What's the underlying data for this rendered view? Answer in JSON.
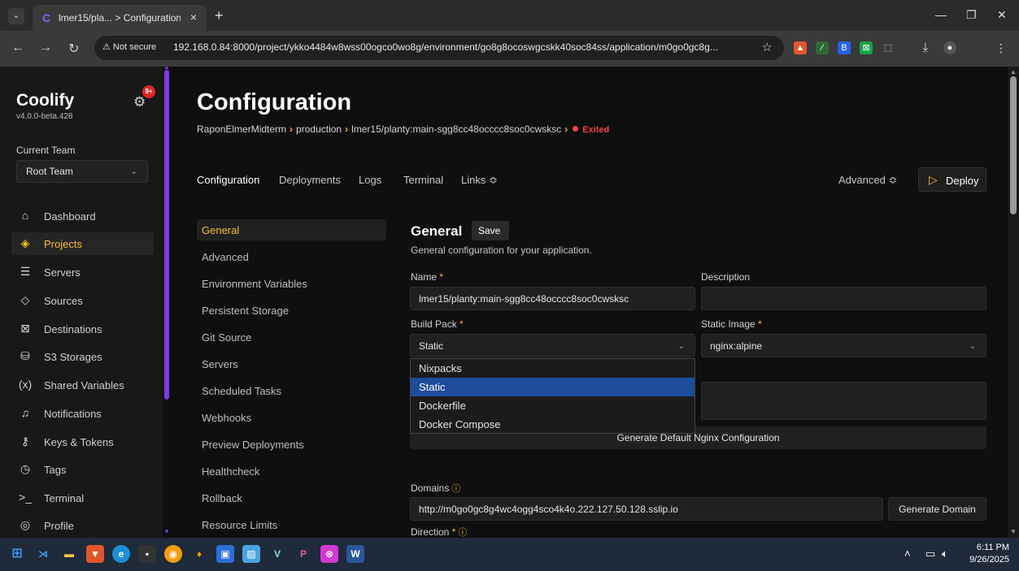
{
  "browser": {
    "tab_title": "lmer15/pla... > Configuration | C",
    "tab_close": "×",
    "new_tab": "+",
    "not_secure": "⚠ Not secure",
    "url": "192.168.0.84:8000/project/ykko4484w8wss00ogco0wo8g/environment/go8g8ocoswgcskk40soc84ss/application/m0go0gc8g..."
  },
  "sidebar": {
    "brand": "Coolify",
    "version": "v4.0.0-beta.428",
    "notif_count": "9+",
    "team_label": "Current Team",
    "team_value": "Root Team",
    "items": [
      {
        "label": "Dashboard",
        "icon": "home-icon"
      },
      {
        "label": "Projects",
        "icon": "layers-icon"
      },
      {
        "label": "Servers",
        "icon": "server-icon"
      },
      {
        "label": "Sources",
        "icon": "git-icon"
      },
      {
        "label": "Destinations",
        "icon": "destination-icon"
      },
      {
        "label": "S3 Storages",
        "icon": "database-icon"
      },
      {
        "label": "Shared Variables",
        "icon": "variable-icon"
      },
      {
        "label": "Notifications",
        "icon": "bell-icon"
      },
      {
        "label": "Keys & Tokens",
        "icon": "key-icon"
      },
      {
        "label": "Tags",
        "icon": "tag-icon"
      },
      {
        "label": "Terminal",
        "icon": "terminal-icon"
      },
      {
        "label": "Profile",
        "icon": "profile-icon"
      }
    ]
  },
  "main": {
    "title": "Configuration",
    "breadcrumb": {
      "project": "RaponElmerMidterm",
      "environment": "production",
      "app": "lmer15/planty:main-sgg8cc48occcc8soc0cwsksc",
      "status": "Exited"
    },
    "tabs": [
      "Configuration",
      "Deployments",
      "Logs",
      "Terminal",
      "Links ≎"
    ],
    "advanced": "Advanced ≎",
    "deploy": "Deploy",
    "subnav": [
      "General",
      "Advanced",
      "Environment Variables",
      "Persistent Storage",
      "Git Source",
      "Servers",
      "Scheduled Tasks",
      "Webhooks",
      "Preview Deployments",
      "Healthcheck",
      "Rollback",
      "Resource Limits"
    ],
    "section_title": "General",
    "save": "Save",
    "section_desc": "General configuration for your application.",
    "name_label": "Name",
    "name_value": "lmer15/planty:main-sgg8cc48occcc8soc0cwsksc",
    "description_label": "Description",
    "description_value": "",
    "buildpack_label": "Build Pack",
    "buildpack_value": "Static",
    "static_image_label": "Static Image",
    "static_image_value": "nginx:alpine",
    "buildpack_options": [
      "Nixpacks",
      "Static",
      "Dockerfile",
      "Docker Compose"
    ],
    "buildpack_selected_index": 1,
    "generate_nginx": "Generate Default Nginx Configuration",
    "domains_label": "Domains",
    "domains_value": "http://m0go0gc8g4wc4ogg4sco4k4o.222.127.50.128.sslip.io",
    "generate_domain": "Generate Domain",
    "direction_label": "Direction"
  },
  "taskbar": {
    "time": "6:11 PM",
    "date": "9/26/2025"
  },
  "colors": {
    "accent": "#fbbf24",
    "brand_purple": "#7c3aed",
    "status_red": "#ef4444",
    "dropdown_highlight": "#1e4c9a"
  }
}
